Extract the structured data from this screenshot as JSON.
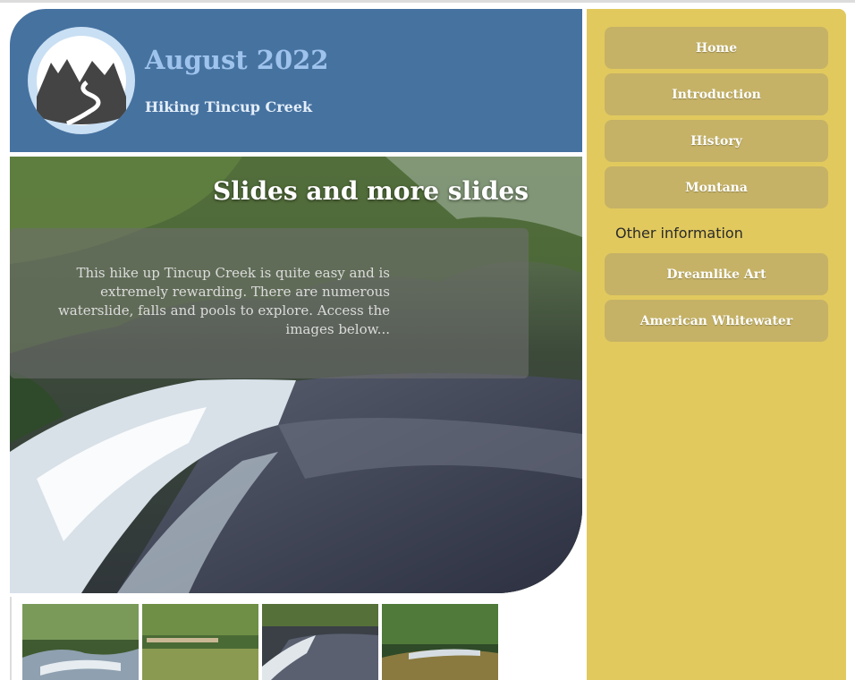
{
  "header": {
    "title": "August 2022",
    "subtitle": "Hiking Tincup Creek",
    "logo_icon": "mountain-river-icon"
  },
  "hero": {
    "heading": "Slides and more slides",
    "text": "This hike up Tincup Creek is quite easy and is extremely rewarding. There are numerous waterslide, falls and pools to explore. Access the images below..."
  },
  "sidebar": {
    "nav": [
      {
        "label": "Home"
      },
      {
        "label": "Introduction"
      },
      {
        "label": "History"
      },
      {
        "label": "Montana"
      }
    ],
    "other_heading": "Other information",
    "links": [
      {
        "label": "Dreamlike Art"
      },
      {
        "label": "American Whitewater"
      }
    ]
  },
  "colors": {
    "header_bg": "#4672a0",
    "title": "#9ec3ec",
    "sidebar_bg": "#e1c95e",
    "button_bg": "#c5b266"
  }
}
